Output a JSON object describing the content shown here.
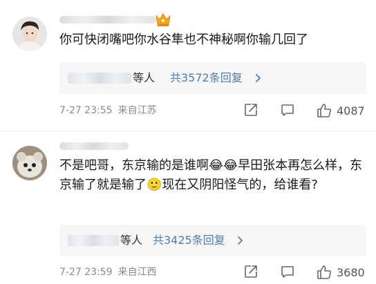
{
  "comments": [
    {
      "text": "你可快闭嘴吧你水谷隼也不神秘啊你输几回了",
      "reply_suffix": "等人",
      "reply_count": "共3572条回复",
      "time": "7-27 23:55",
      "location": "来自江苏",
      "likes": "4087",
      "has_crown_badge": true
    },
    {
      "text": "不是吧哥，东京输的是谁啊😂😂早田张本再怎么样，东京输了就是输了🙂现在又阴阳怪气的，给谁看?",
      "reply_suffix": "等人",
      "reply_count": "共3425条回复",
      "time": "7-27 23:59",
      "location": "来自江西",
      "likes": "3680",
      "has_crown_badge": false
    }
  ],
  "colors": {
    "link_blue": "#507daf",
    "meta_gray": "#8a8a8a",
    "reply_bg": "#f6f6f6",
    "crown_gold": "#f5a623"
  },
  "icons": [
    "crown-icon",
    "chevron-right-icon",
    "share-icon",
    "comment-icon",
    "like-icon"
  ]
}
